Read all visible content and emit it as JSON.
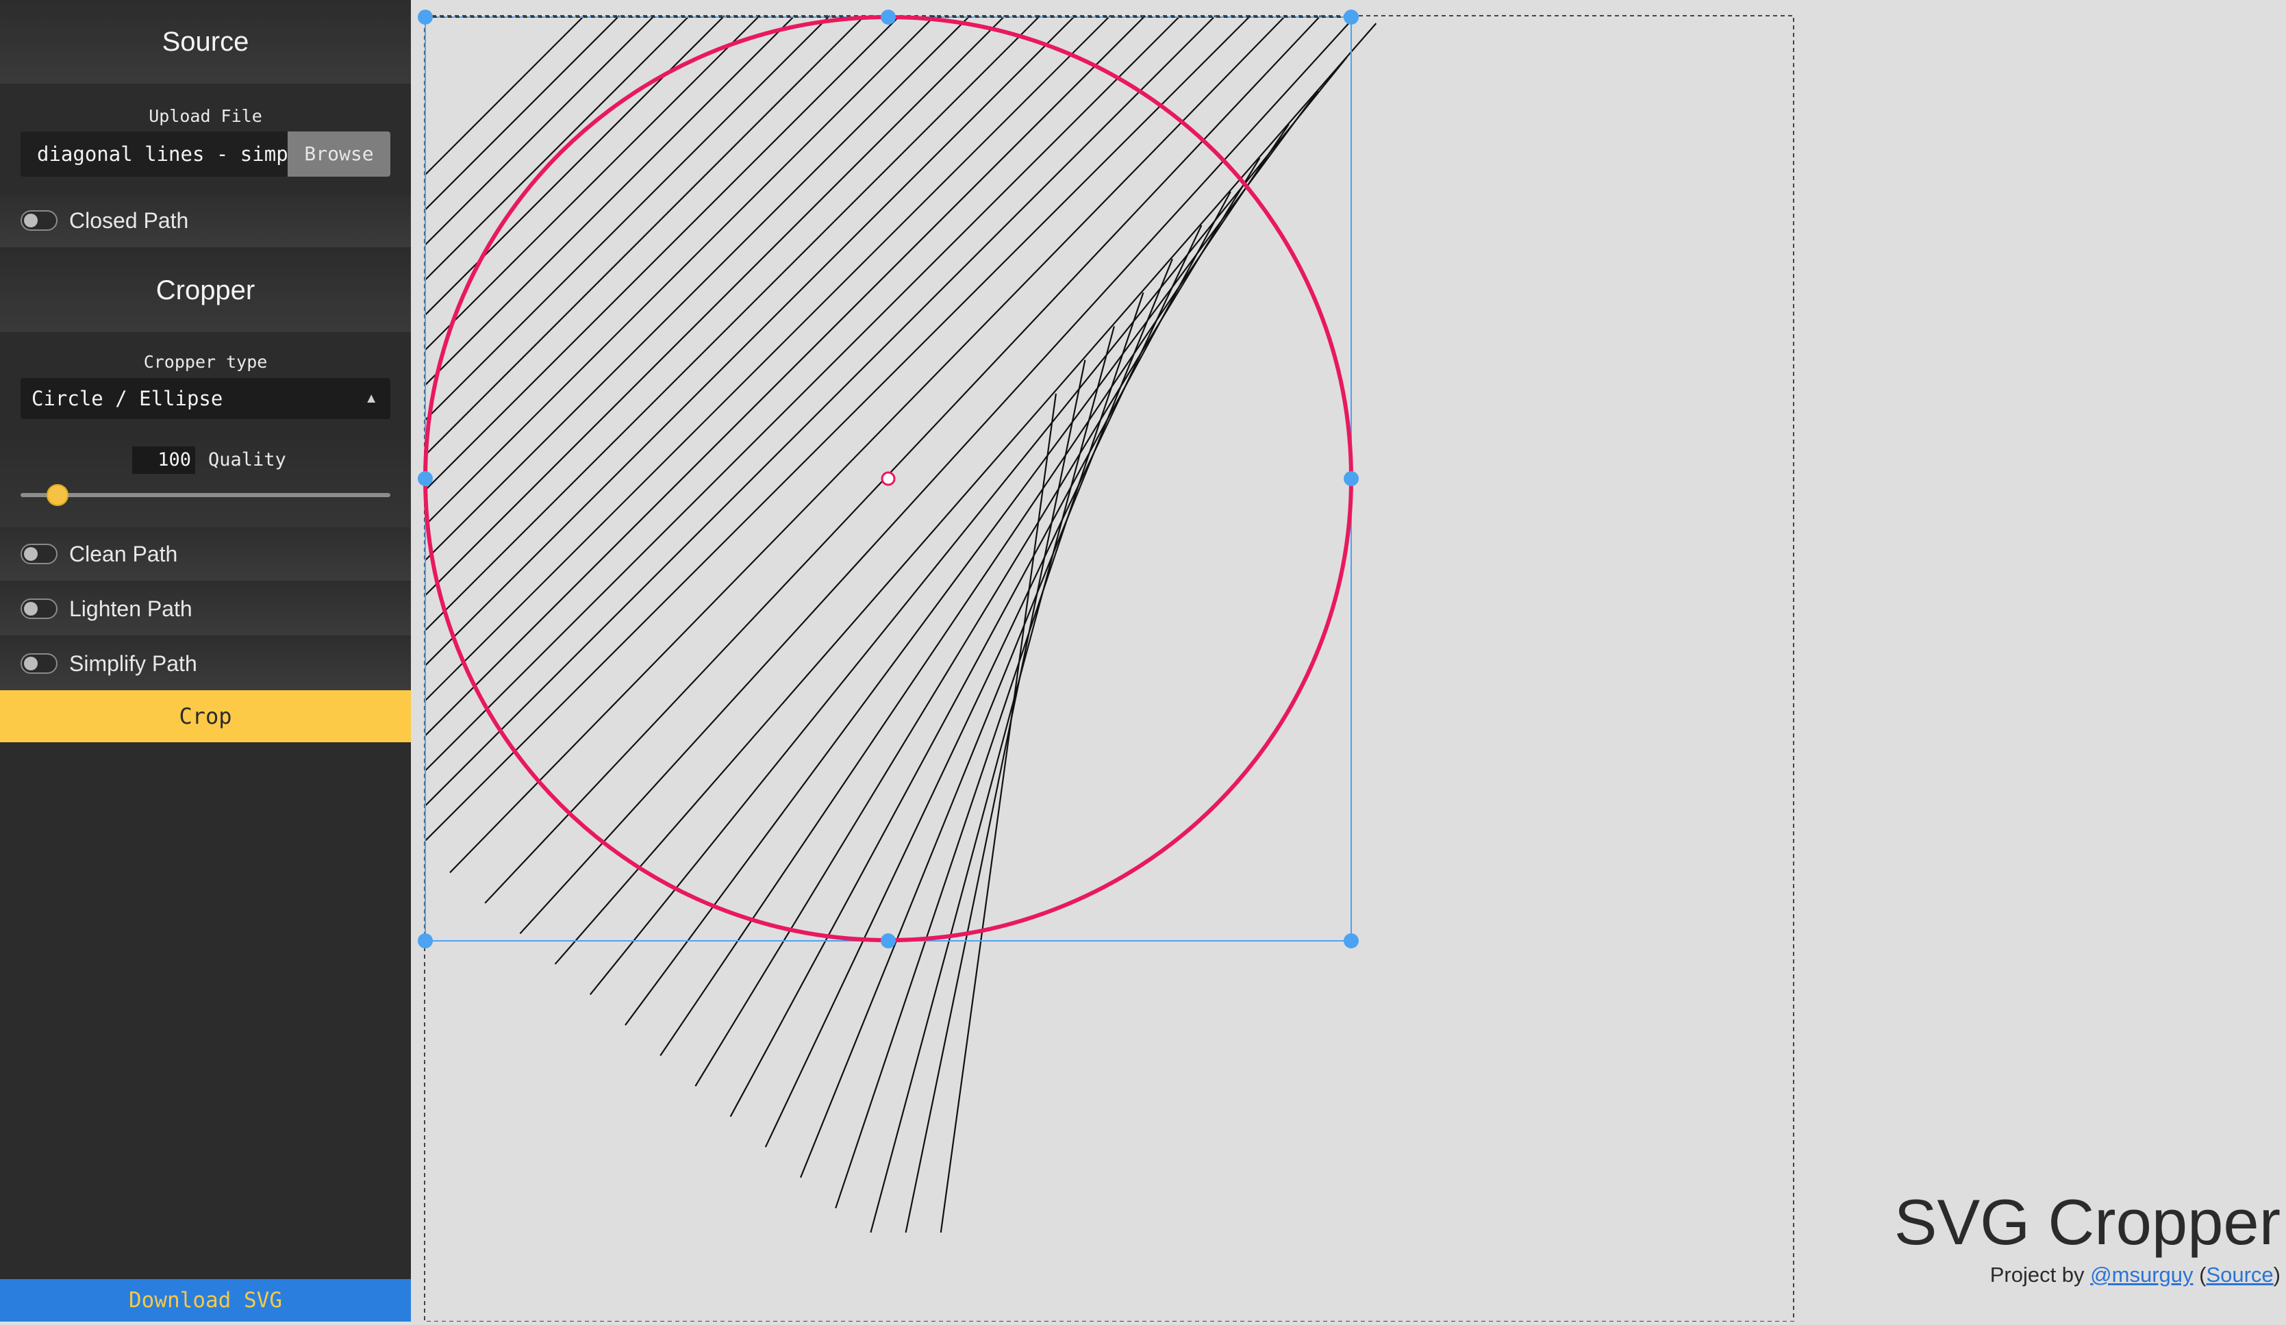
{
  "sidebar": {
    "source_heading": "Source",
    "upload_label": "Upload File",
    "file_name": "diagonal lines - simple.svg",
    "browse_label": "Browse",
    "closed_path_label": "Closed Path",
    "cropper_heading": "Cropper",
    "cropper_type_label": "Cropper type",
    "cropper_type_value": "Circle / Ellipse",
    "quality_value": "100",
    "quality_label": "Quality",
    "quality_slider_fraction": 0.07,
    "clean_path_label": "Clean Path",
    "lighten_path_label": "Lighten Path",
    "simplify_path_label": "Simplify Path",
    "crop_label": "Crop",
    "download_label": "Download SVG"
  },
  "footer": {
    "app_title": "SVG Cropper",
    "byline_prefix": "Project by ",
    "author_link": "@msurguy",
    "paren_open": " (",
    "source_link": "Source",
    "paren_close": ")"
  },
  "colors": {
    "sidebar_bg": "#2c2c2c",
    "accent_yellow": "#fcca47",
    "download_blue": "#2a7fde",
    "ellipse_stroke": "#e8195e",
    "handle_blue": "#4ba3f2",
    "canvas_bg": "#dedede"
  },
  "toggles": {
    "closed_path": false,
    "clean_path": false,
    "lighten_path": false,
    "simplify_path": false
  },
  "icons": {
    "select_arrow": "updown-chevron-icon"
  }
}
